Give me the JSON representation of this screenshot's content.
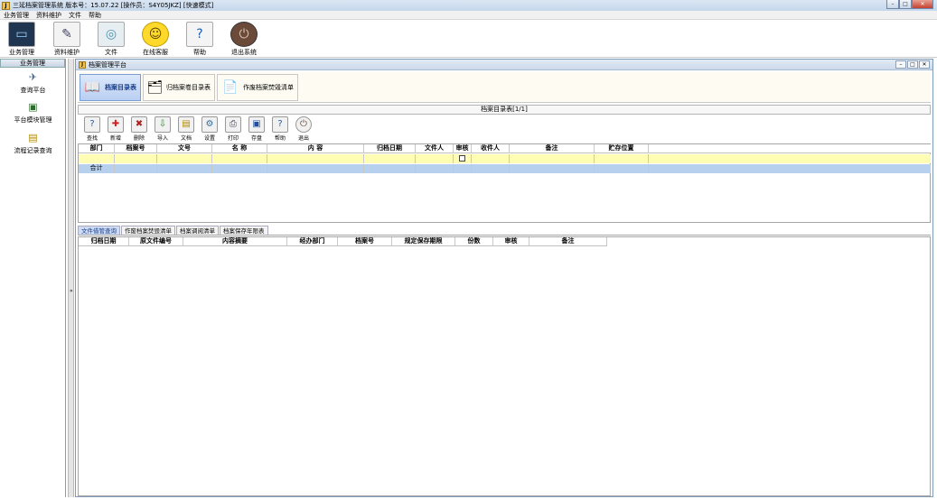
{
  "window": {
    "title": "三延档案管理系统  版本号：15.07.22  [操作员：S4Y05JKZ]  [快速模式]",
    "controls": [
      "–",
      "□",
      "✕"
    ]
  },
  "menu": [
    "业务管理",
    "资料维护",
    "文件",
    "帮助"
  ],
  "main_toolbar": [
    {
      "label": "业务管理",
      "icon": "monitor-icon"
    },
    {
      "label": "资料维护",
      "icon": "document-edit-icon"
    },
    {
      "label": "文件",
      "icon": "disc-icon"
    },
    {
      "label": "在线客服",
      "icon": "smiley-icon"
    },
    {
      "label": "帮助",
      "icon": "help-icon"
    },
    {
      "label": "退出系统",
      "icon": "power-icon"
    }
  ],
  "left_pane": {
    "header": "业务管理",
    "items": [
      {
        "label": "查询平台",
        "icon": "satellite-icon"
      },
      {
        "label": "平台模块管理",
        "icon": "module-icon"
      },
      {
        "label": "流程记录查询",
        "icon": "record-icon"
      }
    ]
  },
  "inner_window": {
    "title": "档案管理平台",
    "controls": [
      "–",
      "□",
      "✕"
    ]
  },
  "big_tabs": [
    {
      "label": "档案目录表",
      "icon": "book-icon",
      "active": true
    },
    {
      "label": "归档案卷目录表",
      "icon": "binder-icon",
      "active": false
    },
    {
      "label": "作废档案焚毁清单",
      "icon": "papers-icon",
      "active": false
    }
  ],
  "grid_caption": "档案目录表[1/1]",
  "sub_toolbar": [
    {
      "label": "查找",
      "icon": "find-icon"
    },
    {
      "label": "新增",
      "icon": "add-icon"
    },
    {
      "label": "删除",
      "icon": "delete-icon"
    },
    {
      "label": "导入",
      "icon": "import-icon"
    },
    {
      "label": "文档",
      "icon": "doc-icon"
    },
    {
      "label": "设置",
      "icon": "settings-icon"
    },
    {
      "label": "打印",
      "icon": "print-icon"
    },
    {
      "label": "存盘",
      "icon": "save-icon"
    },
    {
      "label": "帮助",
      "icon": "help-icon"
    },
    {
      "label": "退出",
      "icon": "exit-icon"
    }
  ],
  "grid1": {
    "columns": [
      "部门",
      "档案号",
      "文号",
      "名  称",
      "内    容",
      "归档日期",
      "文件人",
      "审核",
      "收件人",
      "备注",
      "贮存位置"
    ],
    "total_label": "合计"
  },
  "lower_tabs": [
    {
      "label": "文件借管查询",
      "active": true
    },
    {
      "label": "作废档案焚毁清单",
      "active": false
    },
    {
      "label": "档案调阅清单",
      "active": false
    },
    {
      "label": "档案保存年限表",
      "active": false
    }
  ],
  "grid2": {
    "columns": [
      "归档日期",
      "原文件编号",
      "内容摘要",
      "经办部门",
      "档案号",
      "规定保存期限",
      "份数",
      "审核",
      "备注"
    ]
  }
}
